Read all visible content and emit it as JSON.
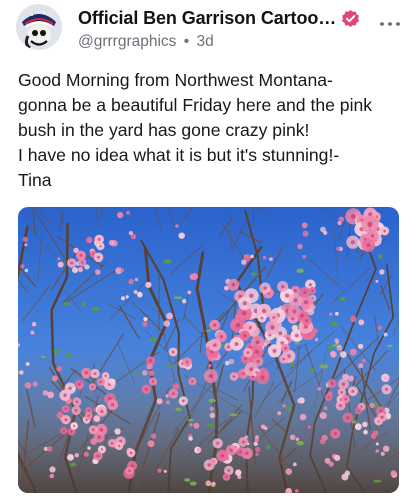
{
  "post": {
    "author": {
      "display_name": "Official  Ben Garrison Cartoo…",
      "handle": "@grrrgraphics",
      "separator": "•",
      "timestamp": "3d",
      "verified_color": "#e0457b"
    },
    "text_lines": [
      "Good Morning from Northwest Montana-",
      "gonna be a beautiful Friday here and the pink",
      "bush in the yard has gone crazy pink!",
      "I have no idea what it is but it's stunning!-",
      "Tina"
    ],
    "media": {
      "kind": "photo",
      "sky_color": "#2f6fd6",
      "blossom_color": "#f08bb0",
      "branch_color": "#5a3f33"
    },
    "icons": [
      "avatar",
      "verified-badge-icon",
      "more-options-icon"
    ]
  }
}
